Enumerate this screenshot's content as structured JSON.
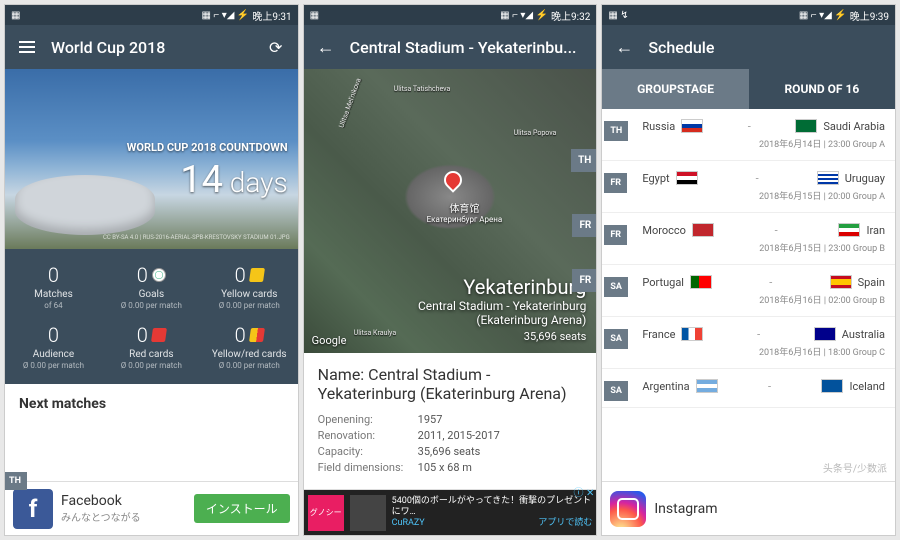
{
  "s1": {
    "status_time": "晚上9:31",
    "title": "World Cup 2018",
    "hero": {
      "countdown_label": "WORLD CUP 2018 COUNTDOWN",
      "days_num": "14",
      "days_word": "days",
      "credit": "CC BY-SA 4.0 | RUS-2016-AERIAL-SPB-KRESTOVSKY STADIUM 01.JPG"
    },
    "stats": [
      {
        "val": "0",
        "label": "Matches",
        "sub": "of 64"
      },
      {
        "val": "0",
        "label": "Goals",
        "sub": "Ø 0.00 per match"
      },
      {
        "val": "0",
        "label": "Yellow cards",
        "sub": "Ø 0.00 per match"
      },
      {
        "val": "0",
        "label": "Audience",
        "sub": "Ø 0.00 per match"
      },
      {
        "val": "0",
        "label": "Red cards",
        "sub": "Ø 0.00 per match"
      },
      {
        "val": "0",
        "label": "Yellow/red cards",
        "sub": "Ø 0.00 per match"
      }
    ],
    "next_matches": "Next matches",
    "ad": {
      "name": "Facebook",
      "tagline": "みんなとつながる",
      "cta": "インストール",
      "badge": "TH"
    }
  },
  "s2": {
    "status_time": "晚上9:32",
    "title": "Central Stadium - Yekaterinbu...",
    "map": {
      "cn1": "体育馆",
      "cn2": "Екатеринбург Арена",
      "city": "Yekaterinburg",
      "venue": "Central Stadium - Yekaterinburg (Ekaterinburg Arena)",
      "seats": "35,696 seats",
      "google": "Google",
      "streets": [
        "Ulitsa Mel'nikova",
        "Ulitsa Tatishcheva",
        "Ulitsa Popova",
        "Ulitsa Kraulya"
      ],
      "badges": [
        "TH",
        "FR",
        "FR"
      ]
    },
    "details": {
      "name": "Name: Central Stadium - Yekaterinburg (Ekaterinburg Arena)",
      "rows": [
        {
          "k": "Openening:",
          "v": "1957"
        },
        {
          "k": "Renovation:",
          "v": "2011, 2015-2017"
        },
        {
          "k": "Capacity:",
          "v": "35,696 seats"
        },
        {
          "k": "Field dimensions:",
          "v": "105 x 68 m"
        }
      ]
    },
    "ad": {
      "line1": "5400個のボールがやってきた！衝撃のプレゼントにワ…",
      "line2": "CuRAZY",
      "line3": "アプリで読む"
    }
  },
  "s3": {
    "status_time": "晚上9:39",
    "title": "Schedule",
    "tabs": {
      "active": "GROUPSTAGE",
      "other": "ROUND OF 16"
    },
    "matches": [
      {
        "day": "TH",
        "home": "Russia",
        "hf": "f-ru",
        "away": "Saudi Arabia",
        "af": "f-sa",
        "meta": "2018年6月14日 | 23:00   Group A"
      },
      {
        "day": "FR",
        "home": "Egypt",
        "hf": "f-eg",
        "away": "Uruguay",
        "af": "f-uy",
        "meta": "2018年6月15日 | 20:00   Group A"
      },
      {
        "day": "FR",
        "home": "Morocco",
        "hf": "f-ma",
        "away": "Iran",
        "af": "f-ir",
        "meta": "2018年6月15日 | 23:00   Group B"
      },
      {
        "day": "SA",
        "home": "Portugal",
        "hf": "f-pt",
        "away": "Spain",
        "af": "f-es",
        "meta": "2018年6月16日 | 02:00   Group B"
      },
      {
        "day": "SA",
        "home": "France",
        "hf": "f-fr",
        "away": "Australia",
        "af": "f-au",
        "meta": "2018年6月16日 | 18:00   Group C"
      },
      {
        "day": "SA",
        "home": "Argentina",
        "hf": "f-ar",
        "away": "Iceland",
        "af": "f-is",
        "meta": ""
      }
    ],
    "ad": {
      "name": "Instagram"
    },
    "watermark": "头条号/少数派"
  },
  "status_icons": "▦ ⌐ ▾◢ ⚡"
}
